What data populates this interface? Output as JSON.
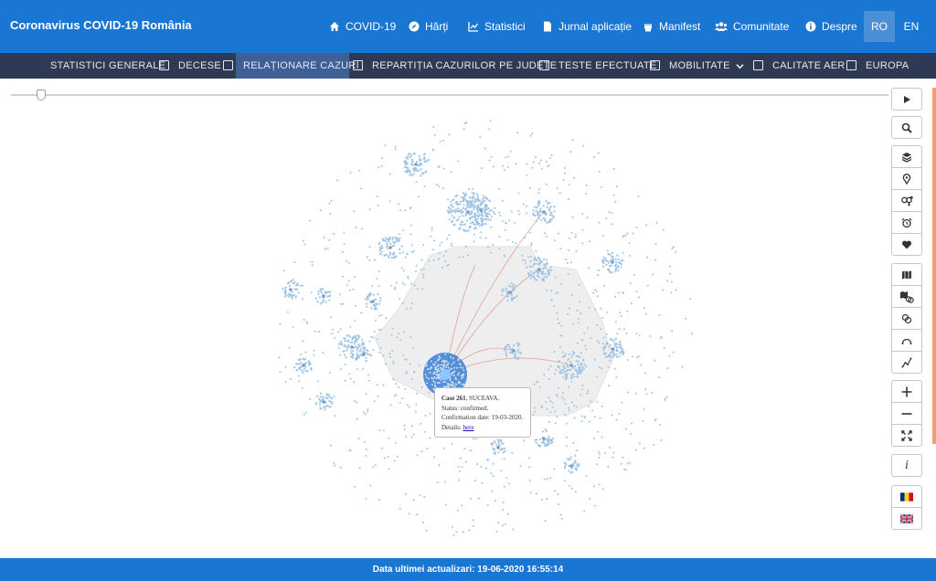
{
  "header": {
    "title": "Coronavirus COVID-19 România",
    "nav": [
      {
        "label": "COVID-19",
        "icon": "home-icon"
      },
      {
        "label": "Hărți",
        "icon": "compass-icon"
      },
      {
        "label": "Statistici",
        "icon": "chart-line-icon"
      },
      {
        "label": "Jurnal aplicație",
        "icon": "document-icon"
      },
      {
        "label": "Manifest",
        "icon": "fist-icon"
      },
      {
        "label": "Comunitate",
        "icon": "users-icon"
      },
      {
        "label": "Despre",
        "icon": "info-icon"
      }
    ],
    "languages": [
      {
        "label": "RO",
        "active": true
      },
      {
        "label": "EN",
        "active": false
      }
    ]
  },
  "subnav": {
    "items": [
      {
        "label": "STATISTICI GENERALE",
        "active": false
      },
      {
        "label": "DECESE",
        "active": false
      },
      {
        "label": "RELAȚIONARE CAZURI",
        "active": true
      },
      {
        "label": "REPARTIȚIA CAZURILOR PE JUDEȚE",
        "active": false
      },
      {
        "label": "TESTE EFECTUATE",
        "active": false
      },
      {
        "label": "MOBILITATE",
        "active": false,
        "dropdown": true
      },
      {
        "label": "CALITATE AER",
        "active": false
      },
      {
        "label": "EUROPA",
        "active": false
      }
    ]
  },
  "timeline": {
    "position": 0.03
  },
  "tooltip": {
    "case": "Case 261",
    "county": ", SUCEAVA.",
    "status": "Status: confirmed.",
    "confirmation": "Confirmation date: 19-03-2020.",
    "details_label": "Details: ",
    "details_link": "here"
  },
  "toolbar": {
    "italic_label": "i",
    "tools": [
      "play-icon",
      "search-icon",
      "layers-icon",
      "map-pin-icon",
      "gender-icon",
      "alarm-clock-icon",
      "heart-hand-icon",
      "map-icon",
      "map-link-icon",
      "link-icon",
      "arc-icon",
      "zigzag-icon",
      "zoom-in-icon",
      "zoom-out-icon",
      "fit-screen-icon",
      "info-italic-icon",
      "flag-romania-icon",
      "flag-uk-icon"
    ]
  },
  "colors": {
    "header": "#1976d2",
    "subnav": "#2e3a54",
    "subnav_active": "#3e5f97",
    "node": "#9fc4e6",
    "hub": "#3a7fd4",
    "map_shape": "#eeeeee",
    "link": "#d66a6a"
  },
  "footer": {
    "text": "Data ultimei actualizari: 19-06-2020 16:55:14"
  }
}
